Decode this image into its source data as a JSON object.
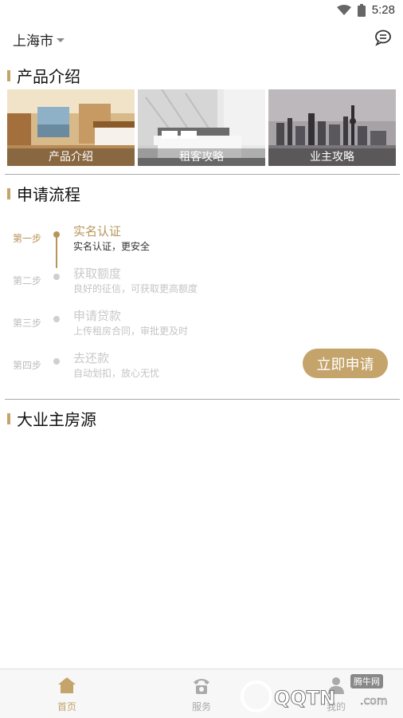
{
  "status_bar": {
    "time": "5:28"
  },
  "header": {
    "city": "上海市"
  },
  "sections": {
    "products": "产品介绍",
    "process": "申请流程",
    "listings": "大业主房源"
  },
  "products": [
    {
      "caption": "产品介绍",
      "image": "hotel-room-photo"
    },
    {
      "caption": "租客攻略",
      "image": "bedroom-photo"
    },
    {
      "caption": "业主攻略",
      "image": "city-skyline-photo"
    }
  ],
  "steps": [
    {
      "label": "第一步",
      "title": "实名认证",
      "desc": "实名认证，更安全",
      "active": true
    },
    {
      "label": "第二步",
      "title": "获取额度",
      "desc": "良好的征信，可获取更高额度",
      "active": false
    },
    {
      "label": "第三步",
      "title": "申请贷款",
      "desc": "上传租房合同，审批更及时",
      "active": false
    },
    {
      "label": "第四步",
      "title": "去还款",
      "desc": "自动划扣，放心无忧",
      "active": false
    }
  ],
  "apply_button": "立即申请",
  "tabs": [
    {
      "label": "首页",
      "icon": "home-icon",
      "active": true
    },
    {
      "label": "服务",
      "icon": "phone-icon",
      "active": false
    },
    {
      "label": "我的",
      "icon": "user-icon",
      "active": false
    }
  ],
  "watermark": {
    "text": "腾牛网",
    "logo": "QQTN.com"
  },
  "colors": {
    "accent": "#c4a46a",
    "active_step": "#b8955a"
  }
}
